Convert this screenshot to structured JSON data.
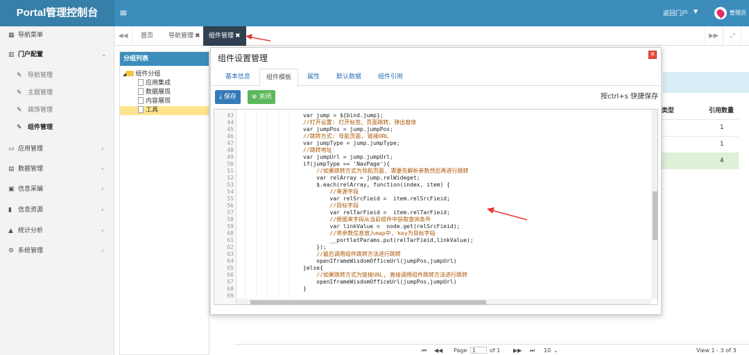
{
  "header": {
    "title": "Portal管理控制台",
    "menu_icon": "hamburger-icon",
    "portal_link": "返回门户",
    "user_name": "管理员"
  },
  "sidebar": {
    "items": [
      {
        "label": "导航菜单",
        "icon": "grid-icon",
        "arrow": ""
      },
      {
        "label": "门户配置",
        "icon": "bank-icon",
        "arrow": "⌄"
      },
      {
        "label": "导航管理",
        "icon": "wrench-icon",
        "arrow": ""
      },
      {
        "label": "主题管理",
        "icon": "wrench-icon",
        "arrow": ""
      },
      {
        "label": "装饰管理",
        "icon": "wrench-icon",
        "arrow": ""
      },
      {
        "label": "组件管理",
        "icon": "wrench-icon",
        "arrow": ""
      },
      {
        "label": "应用管理",
        "icon": "laptop-icon",
        "arrow": "‹"
      },
      {
        "label": "数据管理",
        "icon": "table-icon",
        "arrow": "‹"
      },
      {
        "label": "信息采编",
        "icon": "id-card-icon",
        "arrow": "‹"
      },
      {
        "label": "信息资源",
        "icon": "book-icon",
        "arrow": "‹"
      },
      {
        "label": "统计分析",
        "icon": "chart-icon",
        "arrow": "‹"
      },
      {
        "label": "系统管理",
        "icon": "gears-icon",
        "arrow": "‹"
      }
    ]
  },
  "tabs": [
    {
      "label": "首页",
      "closable": false
    },
    {
      "label": "导航管理",
      "closable": true
    },
    {
      "label": "组件管理",
      "closable": true
    }
  ],
  "group_panel": {
    "title": "分组列表",
    "tree": [
      {
        "label": "组件分组",
        "level": 0,
        "folder": true
      },
      {
        "label": "应用集成",
        "level": 1,
        "folder": false
      },
      {
        "label": "数据展现",
        "level": 1,
        "folder": false
      },
      {
        "label": "内容展现",
        "level": 1,
        "folder": false
      },
      {
        "label": "工具",
        "level": 1,
        "folder": false,
        "selected": true
      }
    ]
  },
  "background_table": {
    "headers": [
      "类型",
      "引用数量"
    ],
    "values": [
      "1",
      "1",
      "4"
    ],
    "pager": {
      "page_label": "Page",
      "page_value": "1",
      "of_label": "of 1",
      "page_size": "10",
      "view": "View 1 - 3 of 3"
    }
  },
  "modal": {
    "title": "组件设置管理",
    "tabs": [
      "基本信息",
      "组件模板",
      "属性",
      "默认数据",
      "组件引用"
    ],
    "active_tab": 1,
    "save_label": "保存",
    "close_label": "关闭",
    "shortcut_hint": "按ctrl+s 快捷保存"
  },
  "code": {
    "lines": [
      {
        "n": "43",
        "t": "var jump = ${bind.jump};"
      },
      {
        "n": "44",
        "t": "//打开设置: 打开标签、页面跳转、弹出窗体"
      },
      {
        "n": "45",
        "t": "var jumpPos = jump.jumpPos;"
      },
      {
        "n": "46",
        "t": "//跳转方式: 导航页面, 链接URL"
      },
      {
        "n": "47",
        "t": "var jumpType = jump.jumpType;"
      },
      {
        "n": "48",
        "t": "//跳转地址"
      },
      {
        "n": "49",
        "t": "var jumpUrl = jump.jumpUrl;"
      },
      {
        "n": "50",
        "t": "if(jumpType == 'NavPage'){"
      },
      {
        "n": "51",
        "t": "    //如果跳转方式为导航页面, 需要先解析参数然后再进行跳转"
      },
      {
        "n": "52",
        "t": "    var relArray = jump.relWideget;"
      },
      {
        "n": "53",
        "t": "    $.each(relArray, function(index, item) {"
      },
      {
        "n": "54",
        "t": "        //来源字段"
      },
      {
        "n": "55",
        "t": "        var relSrcFieid =  item.relSrcFieid;"
      },
      {
        "n": "56",
        "t": "        //目标字段"
      },
      {
        "n": "57",
        "t": "        var relTarFieid =  item.relTarFieid;"
      },
      {
        "n": "58",
        "t": "        //根据来字段从当前组件中获取查询条件"
      },
      {
        "n": "59",
        "t": "        var linkValue =  node.get(relSrcFieid);"
      },
      {
        "n": "60",
        "t": "        //将参数信息放入map中, key为目标字段"
      },
      {
        "n": "61",
        "t": "        __portletParams.put(relTarFieid,linkValue);"
      },
      {
        "n": "62",
        "t": "    });"
      },
      {
        "n": "63",
        "t": "    //最后调用组件跳转方法进行跳转"
      },
      {
        "n": "64",
        "t": "    openIframeWisdomOfficeUrl(jumpPos,jumpUrl)"
      },
      {
        "n": "65",
        "t": "}else{"
      },
      {
        "n": "66",
        "t": "    //如果跳转方式为链接URL, 直接调用组件跳转方法进行跳转"
      },
      {
        "n": "67",
        "t": "    openIframeWisdomOfficeUrl(jumpPos,jumpUrl)"
      },
      {
        "n": "68",
        "t": "}"
      },
      {
        "n": "69",
        "t": ""
      }
    ]
  },
  "colors": {
    "header": "#3c8dbc",
    "logo": "#367fa9",
    "active_tab": "#2f4050",
    "save_button": "#337ab7",
    "close_button": "#5cb85c",
    "annotation_arrow": "#e53935"
  }
}
